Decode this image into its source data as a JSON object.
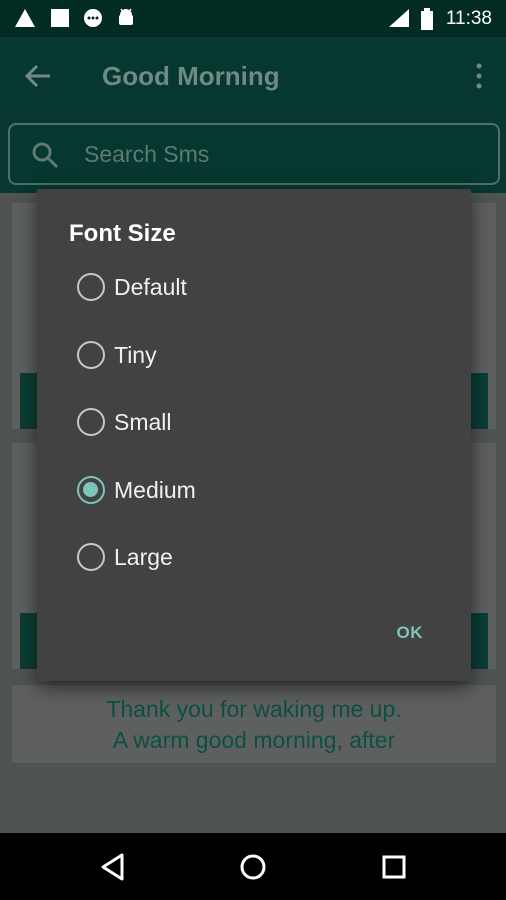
{
  "status_bar": {
    "time": "11:38",
    "icons": [
      "warning-icon",
      "square-icon",
      "chat-icon",
      "android-icon",
      "signal-icon",
      "battery-icon"
    ]
  },
  "app_bar": {
    "title": "Good Morning",
    "back_icon": "arrow-back-icon",
    "more_icon": "more-vert-icon"
  },
  "search": {
    "placeholder": "Search Sms",
    "icon": "search-icon"
  },
  "dialog": {
    "title": "Font Size",
    "options": [
      {
        "label": "Default",
        "selected": false
      },
      {
        "label": "Tiny",
        "selected": false
      },
      {
        "label": "Small",
        "selected": false
      },
      {
        "label": "Medium",
        "selected": true
      },
      {
        "label": "Large",
        "selected": false
      }
    ],
    "ok_label": "OK"
  },
  "background_card": {
    "text_line1": "Thank you for waking me up.",
    "text_line2": "A warm good morning, after"
  },
  "nav_bar": {
    "icons": [
      "back-triangle-icon",
      "home-circle-icon",
      "recents-square-icon"
    ]
  },
  "colors": {
    "app_bar": "#06382f",
    "status_bar": "#022b24",
    "dialog_bg": "#424242",
    "accent": "#7cc5bb"
  }
}
